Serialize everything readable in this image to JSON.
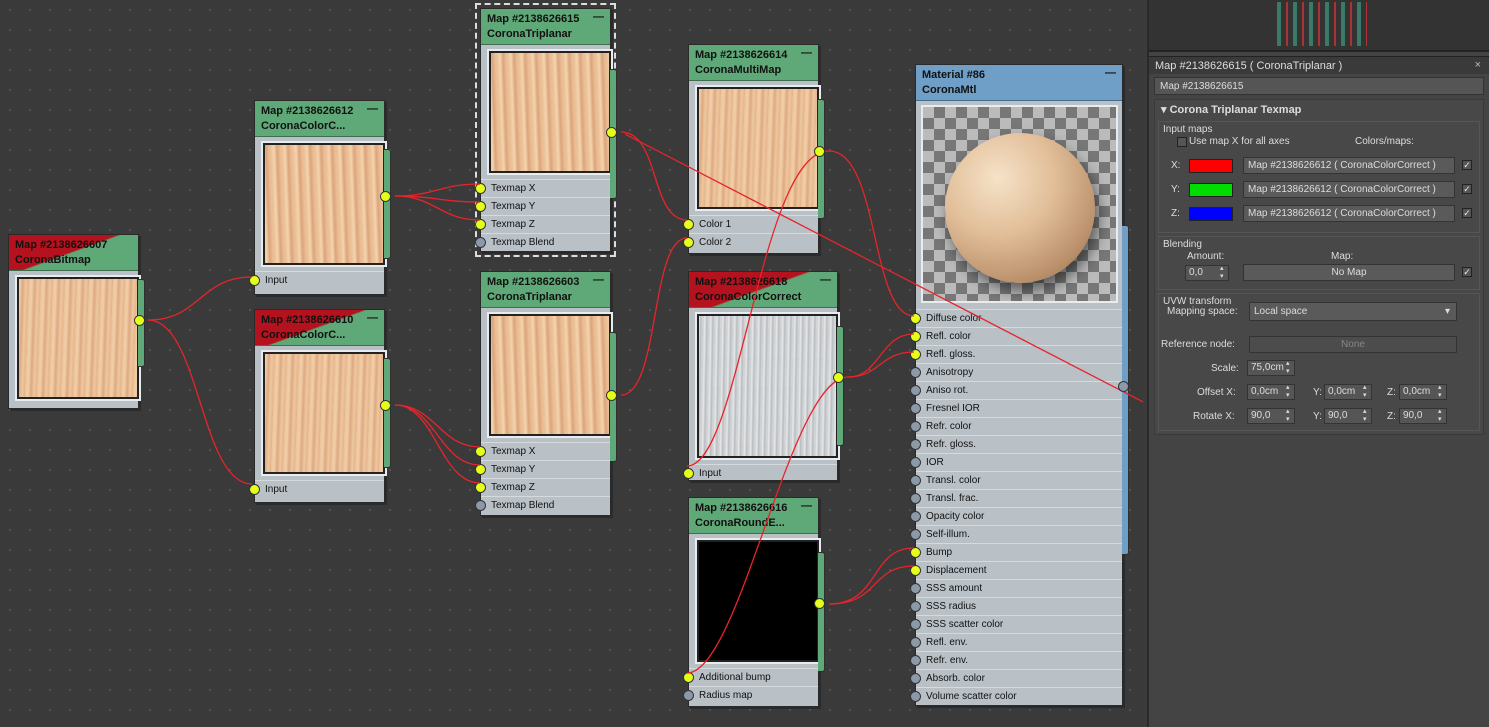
{
  "nodes": {
    "bitmap": {
      "title": "Map #2138626607",
      "type": "CoronaBitmap"
    },
    "cc612": {
      "title": "Map #2138626612",
      "type": "CoronaColorC...",
      "inputs": [
        "Input"
      ]
    },
    "cc610": {
      "title": "Map #2138626610",
      "type": "CoronaColorC...",
      "inputs": [
        "Input"
      ]
    },
    "tri615": {
      "title": "Map #2138626615",
      "type": "CoronaTriplanar",
      "inputs": [
        "Texmap X",
        "Texmap Y",
        "Texmap Z",
        "Texmap Blend"
      ]
    },
    "tri603": {
      "title": "Map #2138626603",
      "type": "CoronaTriplanar",
      "inputs": [
        "Texmap X",
        "Texmap Y",
        "Texmap Z",
        "Texmap Blend"
      ]
    },
    "multi614": {
      "title": "Map #2138626614",
      "type": "CoronaMultiMap",
      "inputs": [
        "Color 1",
        "Color 2"
      ]
    },
    "cc618": {
      "title": "Map #2138626618",
      "type": "CoronaColorCorrect",
      "inputs": [
        "Input"
      ]
    },
    "round616": {
      "title": "Map #2138626616",
      "type": "CoronaRoundE...",
      "inputs": [
        "Additional bump",
        "Radius map"
      ]
    },
    "mtl86": {
      "title": "Material #86",
      "type": "CoronaMtl",
      "inputs": [
        "Diffuse color",
        "Refl. color",
        "Refl. gloss.",
        "Anisotropy",
        "Aniso rot.",
        "Fresnel IOR",
        "Refr. color",
        "Refr. gloss.",
        "IOR",
        "Transl. color",
        "Transl. frac.",
        "Opacity color",
        "Self-illum.",
        "Bump",
        "Displacement",
        "SSS amount",
        "SSS radius",
        "SSS scatter color",
        "Refl. env.",
        "Refr. env.",
        "Absorb. color",
        "Volume scatter color"
      ]
    }
  },
  "panel": {
    "title": "Map #2138626615  ( CoronaTriplanar )",
    "name_field": "Map #2138626615",
    "rollout": "Corona Triplanar Texmap",
    "input_maps": {
      "label": "Input maps",
      "use_x_label": "Use map X for all axes",
      "colors_maps": "Colors/maps:",
      "axes": [
        {
          "axis": "X:",
          "color": "#ff0000",
          "map": "Map #2138626612  ( CoronaColorCorrect )"
        },
        {
          "axis": "Y:",
          "color": "#00dd00",
          "map": "Map #2138626612  ( CoronaColorCorrect )"
        },
        {
          "axis": "Z:",
          "color": "#0000ff",
          "map": "Map #2138626612  ( CoronaColorCorrect )"
        }
      ]
    },
    "blending": {
      "label": "Blending",
      "amount_label": "Amount:",
      "map_label": "Map:",
      "amount": "0,0",
      "map": "No Map"
    },
    "uvw": {
      "label": "UVW transform",
      "mapping_label": "Mapping space:",
      "mapping": "Local space",
      "ref_label": "Reference node:",
      "ref": "None",
      "scale_label": "Scale:",
      "scale": "75,0cm",
      "offset_label": "Offset X:",
      "offset_x": "0,0cm",
      "offset_y_label": "Y:",
      "offset_y": "0,0cm",
      "offset_z_label": "Z:",
      "offset_z": "0,0cm",
      "rotate_label": "Rotate X:",
      "rotate_x": "90,0",
      "rotate_y_label": "Y:",
      "rotate_y": "90,0",
      "rotate_z_label": "Z:",
      "rotate_z": "90,0"
    }
  },
  "colors": {
    "wire": "#e8242a",
    "node_green": "#5fa877",
    "node_blue": "#6f9ec6",
    "pin": "#e4ff1a"
  }
}
